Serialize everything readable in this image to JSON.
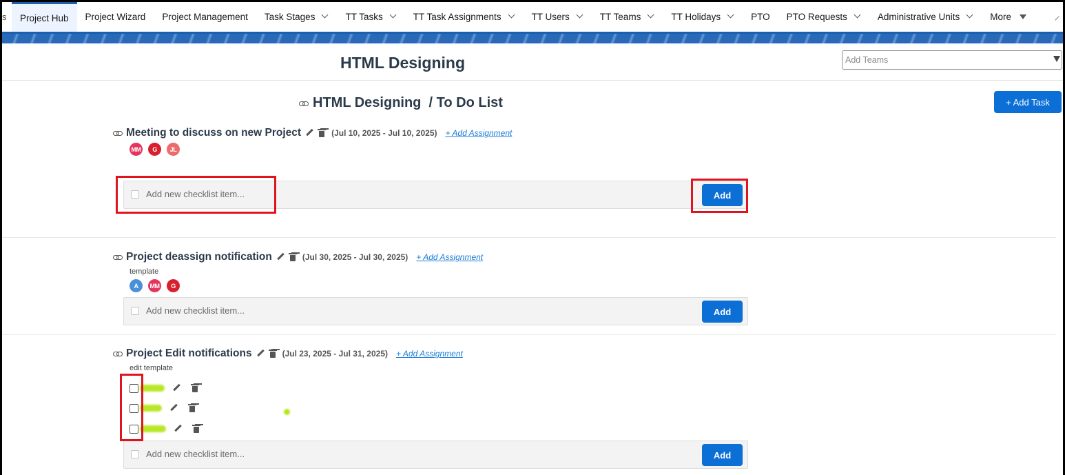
{
  "nav": {
    "edge_glyph": "s",
    "items": [
      {
        "label": "Project Hub",
        "active": true,
        "dropdown": false
      },
      {
        "label": "Project Wizard",
        "dropdown": false
      },
      {
        "label": "Project Management",
        "dropdown": false
      },
      {
        "label": "Task Stages",
        "dropdown": true
      },
      {
        "label": "TT Tasks",
        "dropdown": true
      },
      {
        "label": "TT Task Assignments",
        "dropdown": true
      },
      {
        "label": "TT Users",
        "dropdown": true
      },
      {
        "label": "TT Teams",
        "dropdown": true
      },
      {
        "label": "TT Holidays",
        "dropdown": true
      },
      {
        "label": "PTO",
        "dropdown": false
      },
      {
        "label": "PTO Requests",
        "dropdown": true
      },
      {
        "label": "Administrative Units",
        "dropdown": true
      },
      {
        "label": "More",
        "dropdown": true
      }
    ]
  },
  "header": {
    "project_title": "HTML Designing",
    "teams_placeholder": "Add Teams"
  },
  "list": {
    "title": "HTML Designing  / To Do List",
    "add_task_label": "+ Add Task"
  },
  "checklist": {
    "placeholder": "Add new checklist item...",
    "add_label": "Add"
  },
  "tasks": [
    {
      "name": "Meeting to discuss on new Project",
      "dates": "(Jul 10, 2025 - Jul 10, 2025)",
      "assignment_link": "+ Add Assignment",
      "note": "",
      "avatars": [
        {
          "initials": "MM",
          "color": "#e5355c"
        },
        {
          "initials": "G",
          "color": "#d9202f"
        },
        {
          "initials": "JL",
          "color": "#ec6b6b"
        }
      ]
    },
    {
      "name": "Project deassign notification",
      "dates": "(Jul 30, 2025 - Jul 30, 2025)",
      "assignment_link": "+ Add Assignment",
      "note": "template",
      "avatars": [
        {
          "initials": "A",
          "color": "#4a90d9"
        },
        {
          "initials": "MM",
          "color": "#e5355c"
        },
        {
          "initials": "G",
          "color": "#d9202f"
        }
      ]
    },
    {
      "name": "Project Edit notifications",
      "dates": "(Jul 23, 2025 - Jul 31, 2025)",
      "assignment_link": "+ Add Assignment",
      "note": "edit template",
      "avatars": []
    }
  ],
  "colors": {
    "brand_blue": "#0b6fd6",
    "nav_border": "#1b5fb1",
    "highlight_red": "#e0141e",
    "redaction_green": "#b5e61d"
  }
}
